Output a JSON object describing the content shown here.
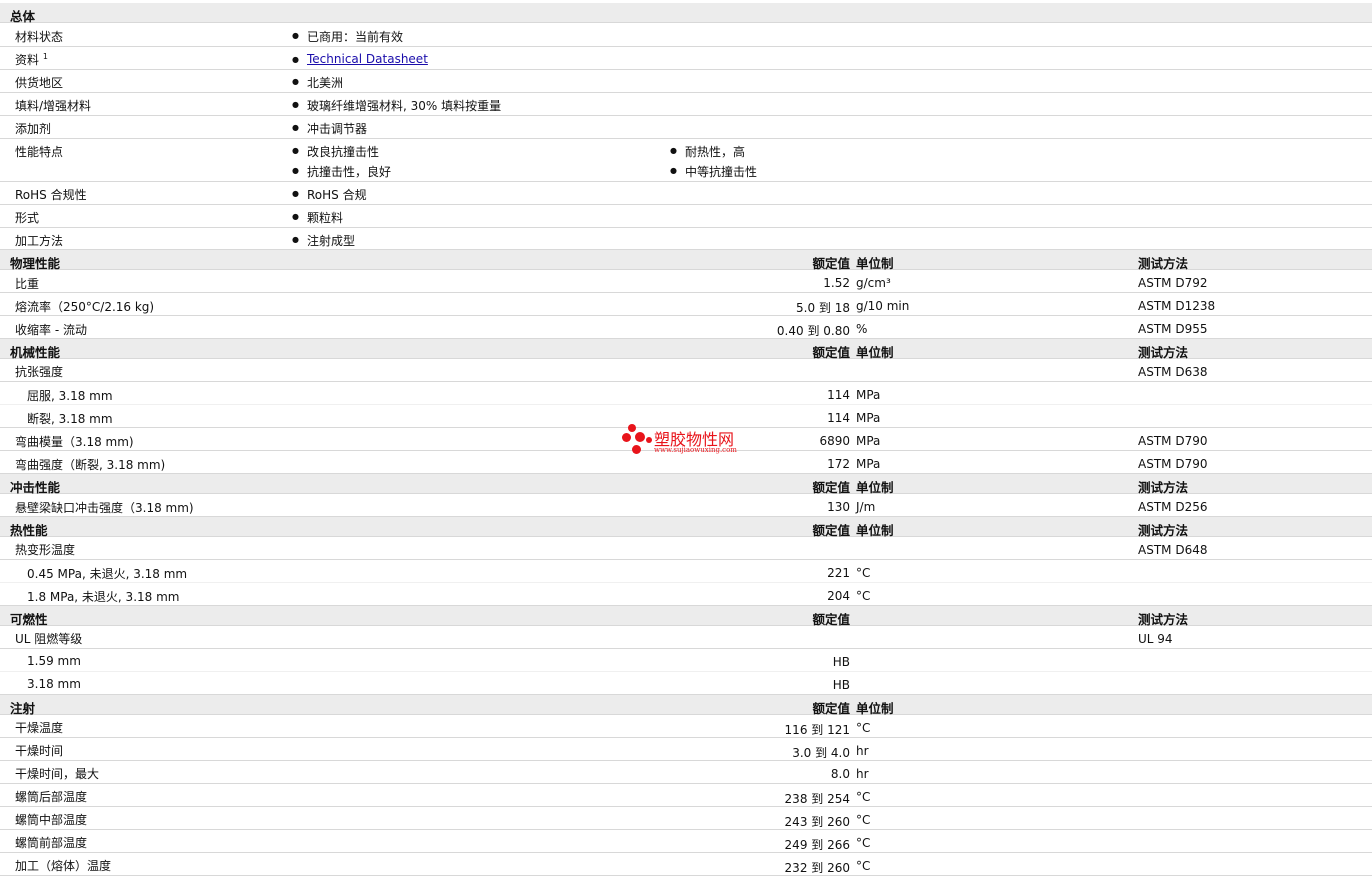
{
  "general": {
    "title": "总体",
    "rows": {
      "status": {
        "label": "材料状态",
        "value": "已商用：当前有效"
      },
      "docs": {
        "label": "资料",
        "sup": "1",
        "value": "Technical Datasheet"
      },
      "region": {
        "label": "供货地区",
        "value": "北美洲"
      },
      "filler": {
        "label": "填料/增强材料",
        "value": "玻璃纤维增强材料, 30% 填料按重量"
      },
      "additive": {
        "label": "添加剂",
        "value": "冲击调节器"
      },
      "features": {
        "label": "性能特点",
        "values": [
          "改良抗撞击性",
          "耐热性，高",
          "抗撞击性，良好",
          "中等抗撞击性"
        ]
      },
      "rohs": {
        "label": "RoHS 合规性",
        "value": "RoHS 合规"
      },
      "form": {
        "label": "形式",
        "value": "颗粒料"
      },
      "processing": {
        "label": "加工方法",
        "value": "注射成型"
      }
    }
  },
  "columns": {
    "nominal": "额定值",
    "unit": "单位制",
    "method": "测试方法"
  },
  "physical": {
    "title": "物理性能",
    "rows": [
      {
        "label": "比重",
        "value": "1.52",
        "unit": "g/cm³",
        "method": "ASTM D792"
      },
      {
        "label": "熔流率（250°C/2.16 kg)",
        "value": "5.0 到  18",
        "unit": "g/10 min",
        "method": "ASTM D1238"
      },
      {
        "label": "收缩率 - 流动",
        "value": "0.40 到  0.80",
        "unit": "%",
        "method": "ASTM D955"
      }
    ]
  },
  "mechanical": {
    "title": "机械性能",
    "rows": [
      {
        "label": "抗张强度",
        "value": "",
        "unit": "",
        "method": "ASTM D638"
      },
      {
        "label": "屈服, 3.18 mm",
        "value": "114",
        "unit": "MPa",
        "method": ""
      },
      {
        "label": "断裂, 3.18 mm",
        "value": "114",
        "unit": "MPa",
        "method": ""
      },
      {
        "label": "弯曲模量（3.18 mm)",
        "value": "6890",
        "unit": "MPa",
        "method": "ASTM D790"
      },
      {
        "label": "弯曲强度（断裂, 3.18 mm)",
        "value": "172",
        "unit": "MPa",
        "method": "ASTM D790"
      }
    ]
  },
  "impact": {
    "title": "冲击性能",
    "rows": [
      {
        "label": "悬壁梁缺口冲击强度（3.18 mm)",
        "value": "130",
        "unit": "J/m",
        "method": "ASTM D256"
      }
    ]
  },
  "thermal": {
    "title": "热性能",
    "rows": [
      {
        "label": "热变形温度",
        "value": "",
        "unit": "",
        "method": "ASTM D648"
      },
      {
        "label": "0.45 MPa, 未退火, 3.18 mm",
        "value": "221",
        "unit": "°C",
        "method": ""
      },
      {
        "label": "1.8 MPa, 未退火, 3.18 mm",
        "value": "204",
        "unit": "°C",
        "method": ""
      }
    ]
  },
  "flammability": {
    "title": "可燃性",
    "rows": [
      {
        "label": "UL 阻燃等级",
        "value": "",
        "method": "UL 94"
      },
      {
        "label": "1.59 mm",
        "value": "HB",
        "method": ""
      },
      {
        "label": "3.18 mm",
        "value": "HB",
        "method": ""
      }
    ]
  },
  "injection": {
    "title": "注射",
    "rows": [
      {
        "label": "干燥温度",
        "value": "116 到  121",
        "unit": "°C"
      },
      {
        "label": "干燥时间",
        "value": "3.0 到  4.0",
        "unit": "hr"
      },
      {
        "label": "干燥时间，最大",
        "value": "8.0",
        "unit": "hr"
      },
      {
        "label": "螺筒后部温度",
        "value": "238 到  254",
        "unit": "°C"
      },
      {
        "label": "螺筒中部温度",
        "value": "243 到  260",
        "unit": "°C"
      },
      {
        "label": "螺筒前部温度",
        "value": "249 到  266",
        "unit": "°C"
      },
      {
        "label": "加工（熔体）温度",
        "value": "232 到  260",
        "unit": "°C"
      }
    ]
  },
  "watermark": {
    "name": "塑胶物性网",
    "url": "www.sujiaowuxing.com",
    "color": "#e8141b"
  }
}
